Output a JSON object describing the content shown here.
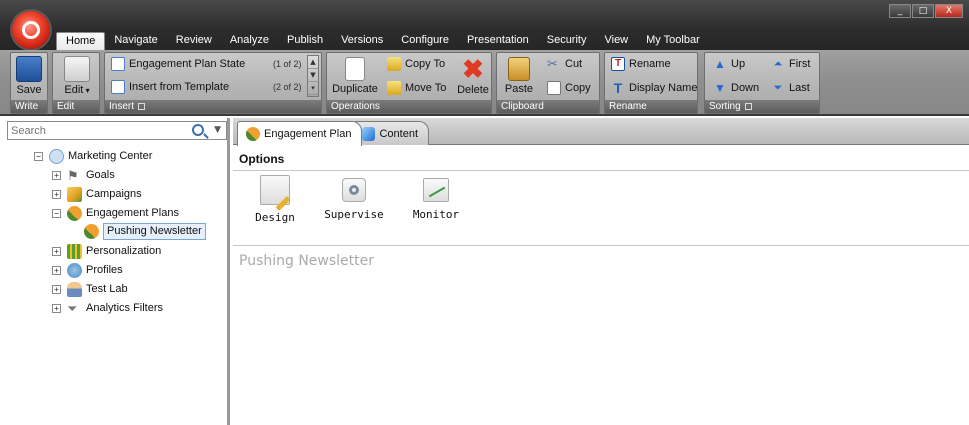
{
  "window": {
    "minimize": "_",
    "maximize": "□",
    "close": "X"
  },
  "ribbon_tabs": [
    "Home",
    "Navigate",
    "Review",
    "Analyze",
    "Publish",
    "Versions",
    "Configure",
    "Presentation",
    "Security",
    "View",
    "My Toolbar"
  ],
  "ribbon": {
    "write": {
      "save": "Save",
      "group_label": "Write"
    },
    "edit": {
      "edit": "Edit",
      "group_label": "Edit"
    },
    "insert": {
      "items": [
        {
          "label": "Engagement Plan State",
          "count": "(1 of 2)"
        },
        {
          "label": "Insert from Template",
          "count": "(2 of 2)"
        }
      ],
      "group_label": "Insert"
    },
    "operations": {
      "duplicate": "Duplicate",
      "copy_to": "Copy To",
      "move_to": "Move To",
      "delete": "Delete",
      "group_label": "Operations"
    },
    "clipboard": {
      "paste": "Paste",
      "cut": "Cut",
      "copy": "Copy",
      "group_label": "Clipboard"
    },
    "rename": {
      "rename": "Rename",
      "display_name": "Display Name",
      "group_label": "Rename"
    },
    "sorting": {
      "up": "Up",
      "down": "Down",
      "first": "First",
      "last": "Last",
      "group_label": "Sorting"
    }
  },
  "search": {
    "placeholder": "Search"
  },
  "tree": [
    {
      "label": "Marketing Center",
      "expander": "−",
      "icon": "marketing-center-icon",
      "color": "#6ea4d8"
    },
    {
      "label": "Goals",
      "expander": "+",
      "icon": "flag-icon",
      "color": "#8a8a8a"
    },
    {
      "label": "Campaigns",
      "expander": "+",
      "icon": "campaigns-icon",
      "color": "#e0a020"
    },
    {
      "label": "Engagement Plans",
      "expander": "−",
      "icon": "engagement-plan-icon",
      "color": "#d07a20"
    },
    {
      "label": "Pushing Newsletter",
      "expander": "",
      "icon": "engagement-plan-icon",
      "color": "#d07a20"
    },
    {
      "label": "Personalization",
      "expander": "+",
      "icon": "personalization-icon",
      "color": "#5aa02c"
    },
    {
      "label": "Profiles",
      "expander": "+",
      "icon": "profiles-icon",
      "color": "#4a8ac0"
    },
    {
      "label": "Test Lab",
      "expander": "+",
      "icon": "test-lab-icon",
      "color": "#c8843a"
    },
    {
      "label": "Analytics Filters",
      "expander": "+",
      "icon": "filter-icon",
      "color": "#7a7a7a"
    }
  ],
  "doc_tabs": [
    "Engagement Plan",
    "Content"
  ],
  "options": {
    "title": "Options",
    "items": [
      "Design",
      "Supervise",
      "Monitor"
    ]
  },
  "item_title": "Pushing Newsletter",
  "colors": {
    "accent_red": "#e03a22",
    "ribbon_gray": "#b5b5b5",
    "selection": "#e6f0fb"
  }
}
